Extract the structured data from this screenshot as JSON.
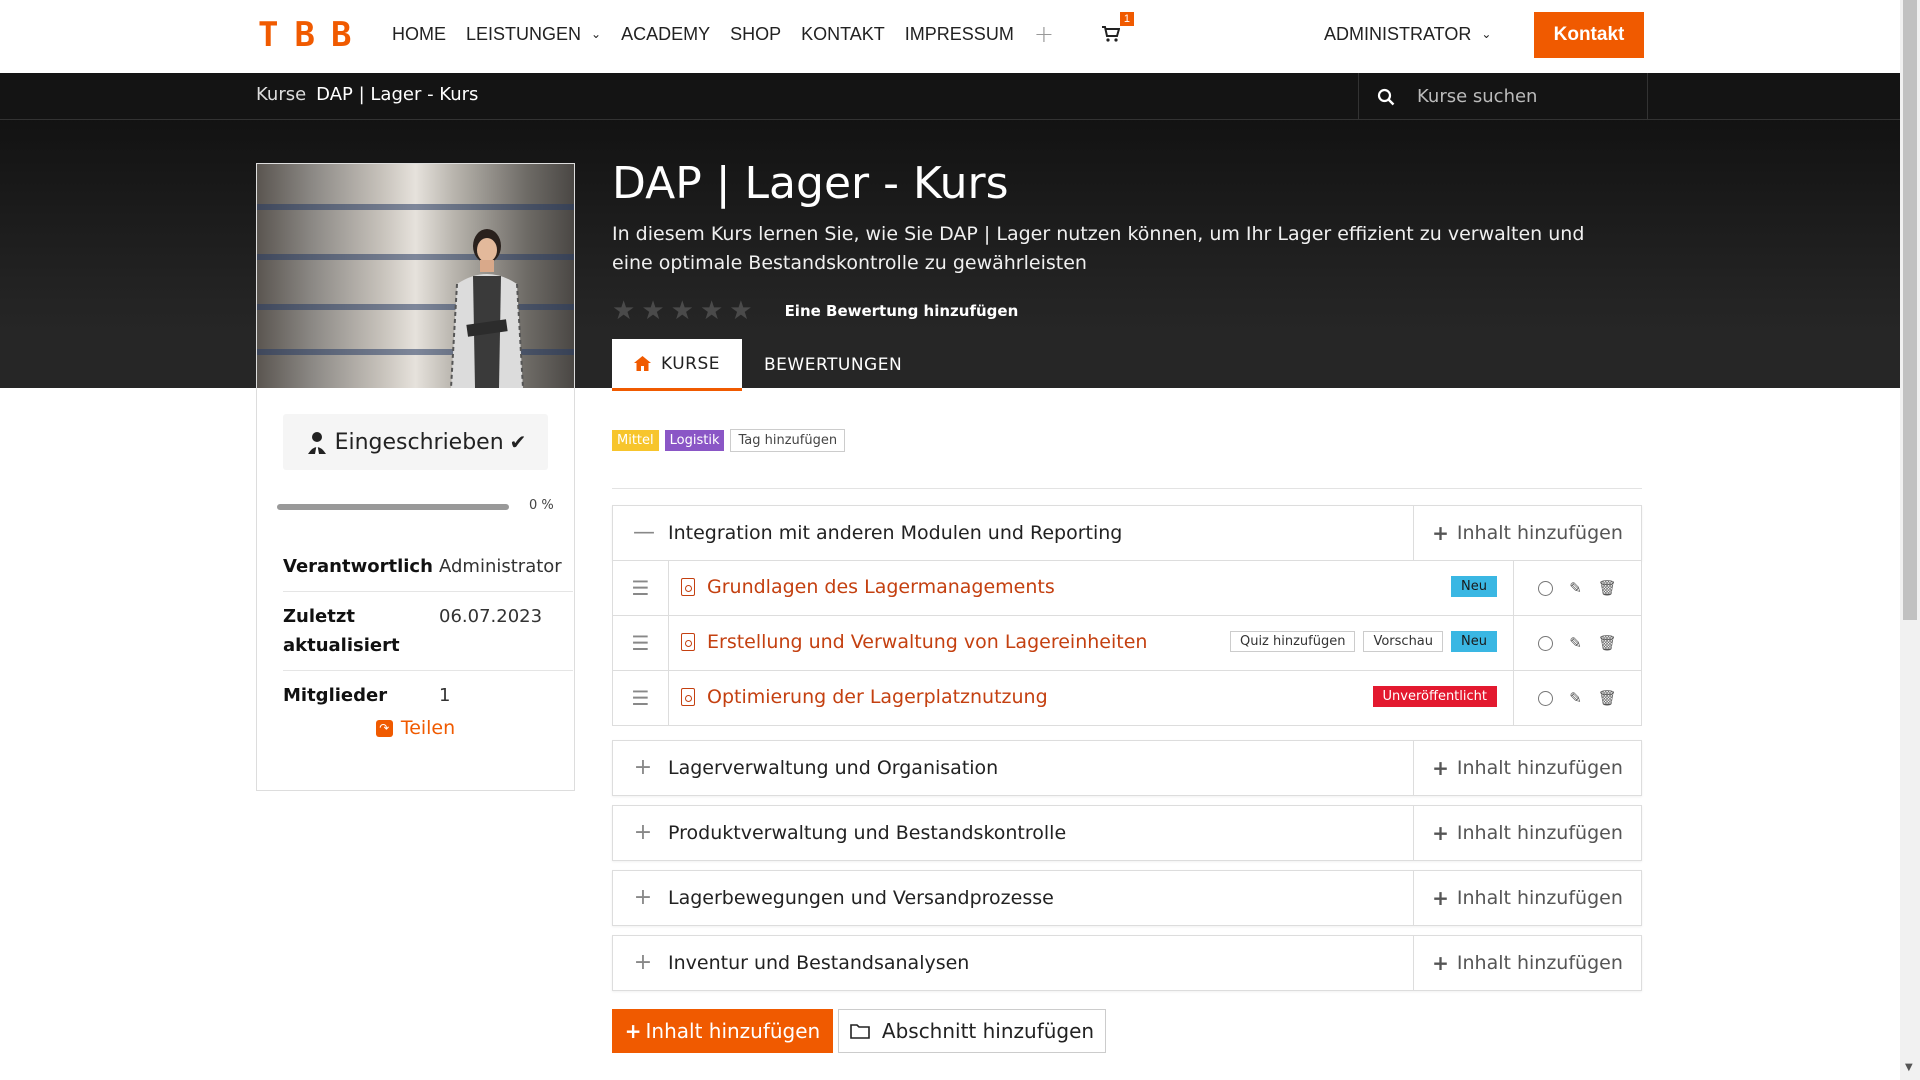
{
  "brand": {
    "logo": [
      "T",
      "B",
      "B"
    ],
    "accent": "#f05a00"
  },
  "nav": {
    "items": [
      {
        "label": "HOME",
        "dropdown": false
      },
      {
        "label": "LEISTUNGEN",
        "dropdown": true
      },
      {
        "label": "ACADEMY",
        "dropdown": false
      },
      {
        "label": "SHOP",
        "dropdown": false
      },
      {
        "label": "KONTAKT",
        "dropdown": false
      },
      {
        "label": "IMPRESSUM",
        "dropdown": false
      }
    ],
    "plus_icon": "plus-icon",
    "cart_count": "1",
    "admin_label": "ADMINISTRATOR",
    "kontakt_button": "Kontakt"
  },
  "breadcrumb": {
    "root": "Kurse",
    "current": "DAP | Lager - Kurs"
  },
  "search": {
    "placeholder": "Kurse suchen"
  },
  "course": {
    "title": "DAP | Lager - Kurs",
    "description": "In diesem Kurs lernen Sie, wie Sie DAP | Lager nutzen können, um Ihr Lager effizient zu verwalten und eine optimale Bestandskontrolle zu gewährleisten",
    "rating_stars": 0,
    "rating_max": 5,
    "rating_link": "Eine Bewertung hinzufügen"
  },
  "tabs": [
    {
      "label": "KURSE",
      "active": true
    },
    {
      "label": "BEWERTUNGEN",
      "active": false
    }
  ],
  "sidebar": {
    "enrolled_label": "Eingeschrieben",
    "progress_percent": 0,
    "progress_label": "0 %",
    "meta": [
      {
        "key": "Verantwortlich",
        "value": "Administrator"
      },
      {
        "key": "Zuletzt aktualisiert",
        "value": "06.07.2023"
      },
      {
        "key": "Mitglieder",
        "value": "1"
      }
    ],
    "share_label": "Teilen"
  },
  "tags": {
    "items": [
      {
        "label": "Mittel",
        "color": "#f7c52c"
      },
      {
        "label": "Logistik",
        "color": "#8a56c6"
      }
    ],
    "add_label": "Tag hinzufügen"
  },
  "add_content_label": "Inhalt hinzufügen",
  "sections": [
    {
      "title": "Integration mit anderen Modulen und Reporting",
      "expanded": true,
      "lessons": [
        {
          "title": "Grundlagen des Lagermanagements",
          "badges": [
            {
              "text": "Neu",
              "type": "neu"
            }
          ]
        },
        {
          "title": "Erstellung und Verwaltung von Lagereinheiten",
          "badges": [
            {
              "text": "Quiz hinzufügen",
              "type": "outline"
            },
            {
              "text": "Vorschau",
              "type": "outline"
            },
            {
              "text": "Neu",
              "type": "neu"
            }
          ]
        },
        {
          "title": "Optimierung der Lagerplatznutzung",
          "badges": [
            {
              "text": "Unveröffentlicht",
              "type": "unpub"
            }
          ]
        }
      ]
    },
    {
      "title": "Lagerverwaltung und Organisation",
      "expanded": false,
      "lessons": []
    },
    {
      "title": "Produktverwaltung und Bestandskontrolle",
      "expanded": false,
      "lessons": []
    },
    {
      "title": "Lagerbewegungen und Versandprozesse",
      "expanded": false,
      "lessons": []
    },
    {
      "title": "Inventur und Bestandsanalysen",
      "expanded": false,
      "lessons": []
    }
  ],
  "footer_buttons": {
    "add_content": "Inhalt hinzufügen",
    "add_section": "Abschnitt hinzufügen"
  }
}
